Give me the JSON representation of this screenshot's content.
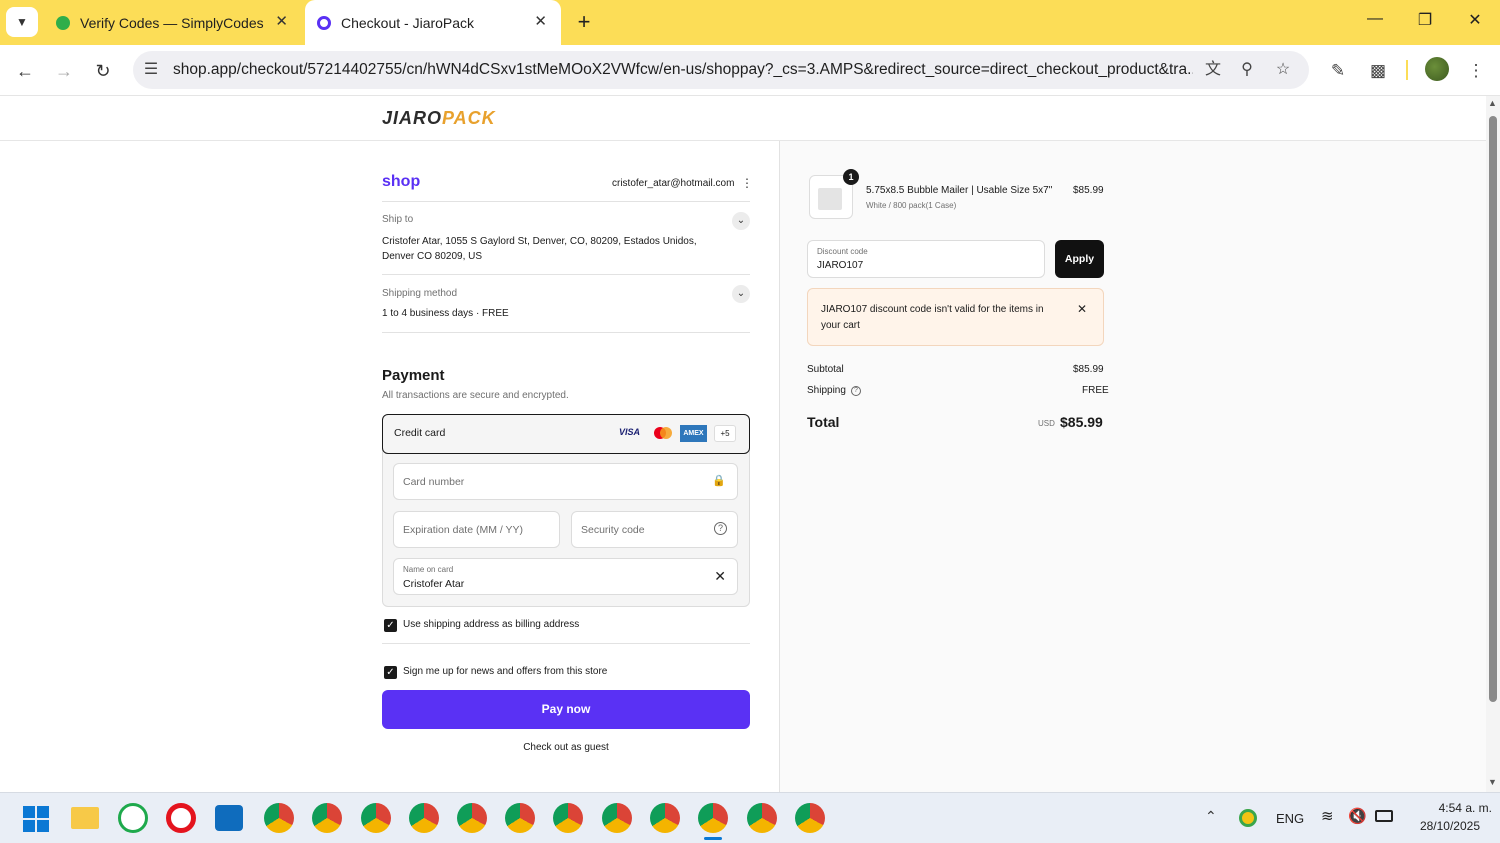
{
  "browser": {
    "tabs": [
      {
        "title": "Verify Codes — SimplyCodes",
        "icon": "simplycodes-icon"
      },
      {
        "title": "Checkout - JiaroPack",
        "icon": "shop-icon"
      }
    ],
    "new_tab": "+",
    "url": "shop.app/checkout/57214402755/cn/hWN4dCSxv1stMeMOoX2VWfcw/en-us/shoppay?_cs=3.AMPS&redirect_source=direct_checkout_product&tra..."
  },
  "store": {
    "logo_a": "JIARO",
    "logo_b": "PACK"
  },
  "checkout": {
    "shop_brand": "shop",
    "account_email": "cristofer_atar@hotmail.com",
    "ship_to_label": "Ship to",
    "ship_to_line1": "Cristofer Atar, 1055 S Gaylord St, Denver, CO, 80209, Estados Unidos,",
    "ship_to_line2": "Denver CO 80209, US",
    "shipping_method_label": "Shipping method",
    "shipping_method_value": "1 to 4 business days · FREE",
    "payment_title": "Payment",
    "payment_subtitle": "All transactions are secure and encrypted.",
    "credit_card_label": "Credit card",
    "card_brands": [
      "VISA",
      "",
      "AMEX",
      "+5"
    ],
    "card_number_placeholder": "Card number",
    "expiry_placeholder": "Expiration date (MM / YY)",
    "security_placeholder": "Security code",
    "name_label": "Name on card",
    "name_value": "Cristofer Atar",
    "billing_checkbox": "Use shipping address as billing address",
    "newsletter_checkbox": "Sign me up for news and offers from this store",
    "pay_button": "Pay now",
    "guest_link": "Check out as guest",
    "accent": "#5a31f4"
  },
  "summary": {
    "item_qty": "1",
    "item_name": "5.75x8.5 Bubble Mailer | Usable Size 5x7\"",
    "item_variant": "White / 800 pack(1 Case)",
    "item_price": "$85.99",
    "discount_label": "Discount code",
    "discount_value": "JIARO107",
    "apply_button": "Apply",
    "error_line1": "JIARO107 discount code isn't valid for the items in",
    "error_line2": "your cart",
    "subtotal_label": "Subtotal",
    "subtotal_value": "$85.99",
    "shipping_label": "Shipping",
    "shipping_value": "FREE",
    "total_label": "Total",
    "total_currency": "USD",
    "total_value": "$85.99"
  },
  "taskbar": {
    "language": "ENG",
    "time": "4:54 a. m.",
    "date": "28/10/2025"
  }
}
